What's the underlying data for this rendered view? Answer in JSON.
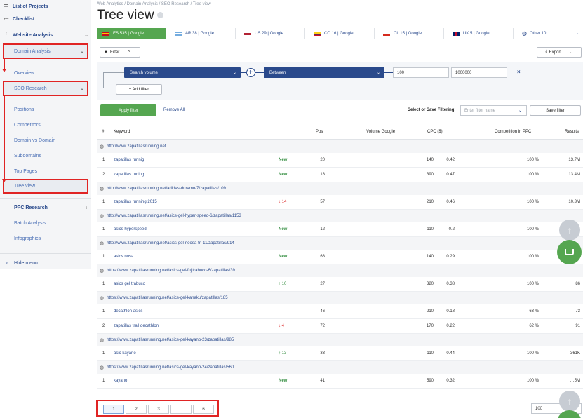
{
  "sidebar": {
    "list_projects": "List of Projects",
    "checklist": "Checklist",
    "website_analysis": "Website Analysis",
    "domain_analysis": "Domain Analysis",
    "overview": "Overview",
    "seo_research": "SEO Research",
    "positions": "Positions",
    "competitors": "Competitors",
    "domain_vs_domain": "Domain vs Domain",
    "subdomains": "Subdomains",
    "top_pages": "Top Pages",
    "tree_view": "Tree view",
    "ppc_research": "PPC Research",
    "batch_analysis": "Batch Analysis",
    "infographics": "Infographics",
    "hide_menu": "Hide menu"
  },
  "header": {
    "breadcrumb": "Web Analytics / Domain Analysis / SEO Research / Tree view",
    "title": "Tree view"
  },
  "tabs": [
    {
      "label": "ES 535 | Google",
      "active": true,
      "flag": [
        "#c60b1e",
        "#ffc400",
        "#c60b1e"
      ]
    },
    {
      "label": "AR 38 | Google",
      "active": false,
      "flag": [
        "#74acdf",
        "#ffffff",
        "#74acdf"
      ]
    },
    {
      "label": "US 29 | Google",
      "active": false,
      "flag": [
        "#b22234",
        "#ffffff",
        "#3c3b6e"
      ]
    },
    {
      "label": "CO 16 | Google",
      "active": false,
      "flag": [
        "#fcd116",
        "#003893",
        "#ce1126"
      ]
    },
    {
      "label": "CL 15 | Google",
      "active": false,
      "flag": [
        "#0039a6",
        "#ffffff",
        "#d52b1e"
      ]
    },
    {
      "label": "UK 5 | Google",
      "active": false,
      "flag": [
        "#012169",
        "#c8102e",
        "#012169"
      ]
    },
    {
      "label": "Other 10",
      "active": false,
      "flag": []
    }
  ],
  "filter": {
    "filter_button": "Filter",
    "export_button": "Export",
    "field": "Search volume",
    "operator": "Between",
    "min": "100",
    "max": "1000000",
    "add_filter": "+ Add filter",
    "apply": "Apply filter",
    "remove_all": "Remove All",
    "select_save_label": "Select or Save Filtering:",
    "filter_name_placeholder": "Enter filter name",
    "save_filter": "Save filter"
  },
  "table": {
    "headers": {
      "num": "#",
      "keyword": "Keyword",
      "pos": "Pos",
      "volume": "Volume Google",
      "cpc": "CPC ($)",
      "competition": "Competition in PPC",
      "results": "Results"
    },
    "groups": [
      {
        "url": "http://www.zapatillasrunning.net",
        "rows": [
          {
            "n": "1",
            "kw": "zapatillas runnig",
            "change": "New",
            "change_type": "new",
            "pos": "20",
            "vol": "140",
            "cpc": "0.42",
            "comp": "100 %",
            "res": "13.7M"
          },
          {
            "n": "2",
            "kw": "zapatillas runing",
            "change": "New",
            "change_type": "new",
            "pos": "18",
            "vol": "390",
            "cpc": "0.47",
            "comp": "100 %",
            "res": "13.4M"
          }
        ]
      },
      {
        "url": "http://www.zapatillasrunning.net/adidas-duramo-7/zapatillas/109",
        "rows": [
          {
            "n": "1",
            "kw": "zapatillas running 2015",
            "change": "↓ 14",
            "change_type": "down",
            "pos": "57",
            "vol": "210",
            "cpc": "0.46",
            "comp": "100 %",
            "res": "10.3M"
          }
        ]
      },
      {
        "url": "http://www.zapatillasrunning.net/asics-gel-hyper-speed-6/zapatillas/1153",
        "rows": [
          {
            "n": "1",
            "kw": "asics hyperspeed",
            "change": "New",
            "change_type": "new",
            "pos": "12",
            "vol": "110",
            "cpc": "0.2",
            "comp": "100 %",
            "res": "…K"
          }
        ]
      },
      {
        "url": "http://www.zapatillasrunning.net/asics-gel-noosa-tri-11/zapatillas/914",
        "rows": [
          {
            "n": "1",
            "kw": "asics nosa",
            "change": "New",
            "change_type": "new",
            "pos": "68",
            "vol": "140",
            "cpc": "0.29",
            "comp": "100 %",
            "res": "425K"
          }
        ]
      },
      {
        "url": "https://www.zapatillasrunning.net/asics-gel-fujitrabuco-6/zapatillas/39",
        "rows": [
          {
            "n": "1",
            "kw": "asics gel trabuco",
            "change": "↑ 10",
            "change_type": "up",
            "pos": "27",
            "vol": "320",
            "cpc": "0.38",
            "comp": "100 %",
            "res": "86"
          }
        ]
      },
      {
        "url": "https://www.zapatillasrunning.net/asics-gel-kanaku/zapatillas/185",
        "rows": [
          {
            "n": "1",
            "kw": "decathlon asics",
            "change": "",
            "change_type": "none",
            "pos": "46",
            "vol": "210",
            "cpc": "0.18",
            "comp": "63 %",
            "res": "73"
          },
          {
            "n": "2",
            "kw": "zapatillas trail decathlon",
            "change": "↓ 4",
            "change_type": "down",
            "pos": "72",
            "vol": "170",
            "cpc": "0.22",
            "comp": "62 %",
            "res": "91"
          }
        ]
      },
      {
        "url": "https://www.zapatillasrunning.net/asics-gel-kayano-23/zapatillas/985",
        "rows": [
          {
            "n": "1",
            "kw": "asic kayano",
            "change": "↑ 13",
            "change_type": "up",
            "pos": "33",
            "vol": "110",
            "cpc": "0.44",
            "comp": "100 %",
            "res": "361K"
          }
        ]
      },
      {
        "url": "https://www.zapatillasrunning.net/asics-gel-kayano-24/zapatillas/560",
        "rows": [
          {
            "n": "1",
            "kw": "kayano",
            "change": "New",
            "change_type": "new",
            "pos": "41",
            "vol": "590",
            "cpc": "0.32",
            "comp": "100 %",
            "res": "…5M"
          }
        ]
      }
    ]
  },
  "pagination": {
    "pages": [
      "1",
      "2",
      "3",
      "...",
      "6"
    ],
    "active": "1",
    "per_page": "100"
  },
  "colors": {
    "accent_green": "#55a650",
    "navy": "#2a4a8c",
    "highlight_red": "#e02424"
  }
}
